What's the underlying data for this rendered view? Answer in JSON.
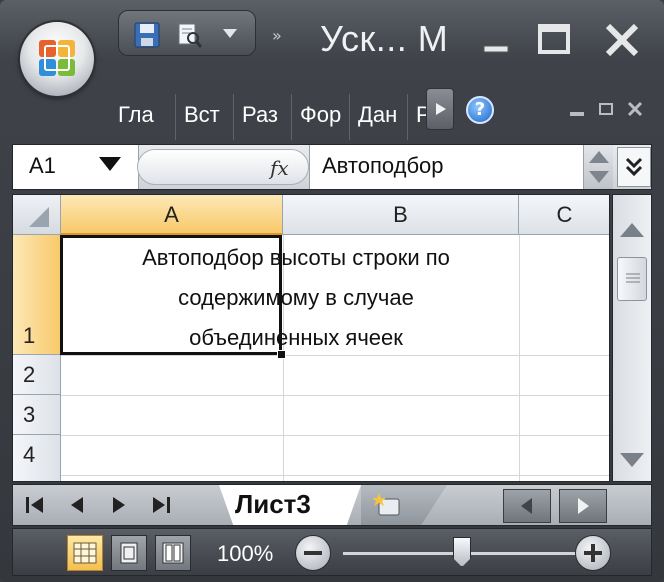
{
  "window": {
    "title": "Уск... М"
  },
  "ribbon": {
    "tabs": [
      "Гла",
      "Вст",
      "Раз",
      "Фор",
      "Дан",
      "Р"
    ]
  },
  "formula_bar": {
    "name_box": "A1",
    "fx_label": "fx",
    "formula": "Автоподбор"
  },
  "grid": {
    "columns": [
      "A",
      "B",
      "C"
    ],
    "rows": [
      "1",
      "2",
      "3",
      "4"
    ],
    "selected_column": "A",
    "selected_row": "1",
    "active_cell": "A1",
    "cell_a1_lines": [
      "Автоподбор высоты строки по",
      "содержимому в случае",
      "объединенных ячеек"
    ]
  },
  "sheets": {
    "active": "Лист3"
  },
  "status": {
    "zoom": "100%"
  },
  "icons": {
    "office_button": "office-logo-icon",
    "save": "save-icon",
    "print_preview": "print-preview-icon",
    "help": "help-icon"
  },
  "colors": {
    "selected_header": "#f8c96a",
    "active_view": "#f4bf4f",
    "chrome_dark": "#3f4349"
  }
}
